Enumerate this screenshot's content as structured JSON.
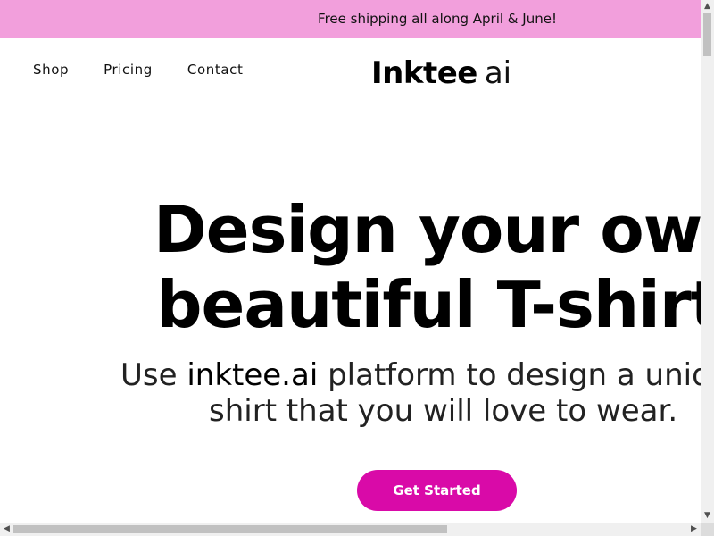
{
  "colors": {
    "banner_bg": "#f29fdc",
    "accent": "#d90aa8",
    "text": "#000000"
  },
  "banner": {
    "text": "Free shipping all along April & June!"
  },
  "nav": {
    "items": [
      {
        "label": "Shop"
      },
      {
        "label": "Pricing"
      },
      {
        "label": "Contact"
      }
    ]
  },
  "logo": {
    "bold": "Inktee",
    "light": "ai"
  },
  "hero": {
    "headline_line1": "Design your own",
    "headline_line2": "beautiful T-shirt",
    "sub_prefix": "Use ",
    "sub_brand": "inktee.ai",
    "sub_line1_rest": " platform to design a unique T-",
    "sub_line2": "shirt that you will love to wear.",
    "cta_label": "Get Started"
  },
  "scrollbars": {
    "up_icon": "triangle-up",
    "down_icon": "triangle-down",
    "left_icon": "triangle-left",
    "right_icon": "triangle-right"
  }
}
